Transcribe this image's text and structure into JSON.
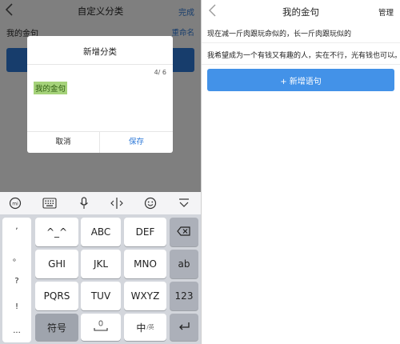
{
  "left": {
    "nav": {
      "title": "自定义分类",
      "done": "完成"
    },
    "row": {
      "name": "我的金句",
      "rename": "重命名"
    },
    "dialog": {
      "title": "新增分类",
      "char_count": "4/ 6",
      "input_value": "我的金句",
      "cancel": "取消",
      "save": "保存"
    },
    "keyboard": {
      "toolbar_icons": [
        "ime-logo-icon",
        "keyboard-icon",
        "microphone-icon",
        "cursor-icon",
        "emoji-icon",
        "collapse-keyboard-icon"
      ],
      "punctuation": [
        ",",
        "。",
        "?",
        "!",
        "..."
      ],
      "keys": {
        "k_emoticon": "^_^",
        "k_abc": "ABC",
        "k_def": "DEF",
        "k_ghi": "GHI",
        "k_jkl": "JKL",
        "k_mno": "MNO",
        "k_ab": "ab",
        "k_pqrs": "PQRS",
        "k_tuv": "TUV",
        "k_wxyz": "WXYZ",
        "k_123": "123",
        "k_symbols": "符号",
        "k_lang_main": "中",
        "k_lang_sub": "/英"
      }
    }
  },
  "right": {
    "nav": {
      "title": "我的金句",
      "manage": "管理"
    },
    "items": [
      {
        "text": "现在减一斤肉跟玩命似的，长一斤肉跟玩似的"
      },
      {
        "text": "我希望成为一个有钱又有趣的人，实在不行，光有钱也可以。"
      }
    ],
    "add_button": "+ 新增语句"
  },
  "colors": {
    "accent": "#2f7ad8",
    "button_blue": "#4392e8",
    "highlight": "#a5d27a"
  }
}
